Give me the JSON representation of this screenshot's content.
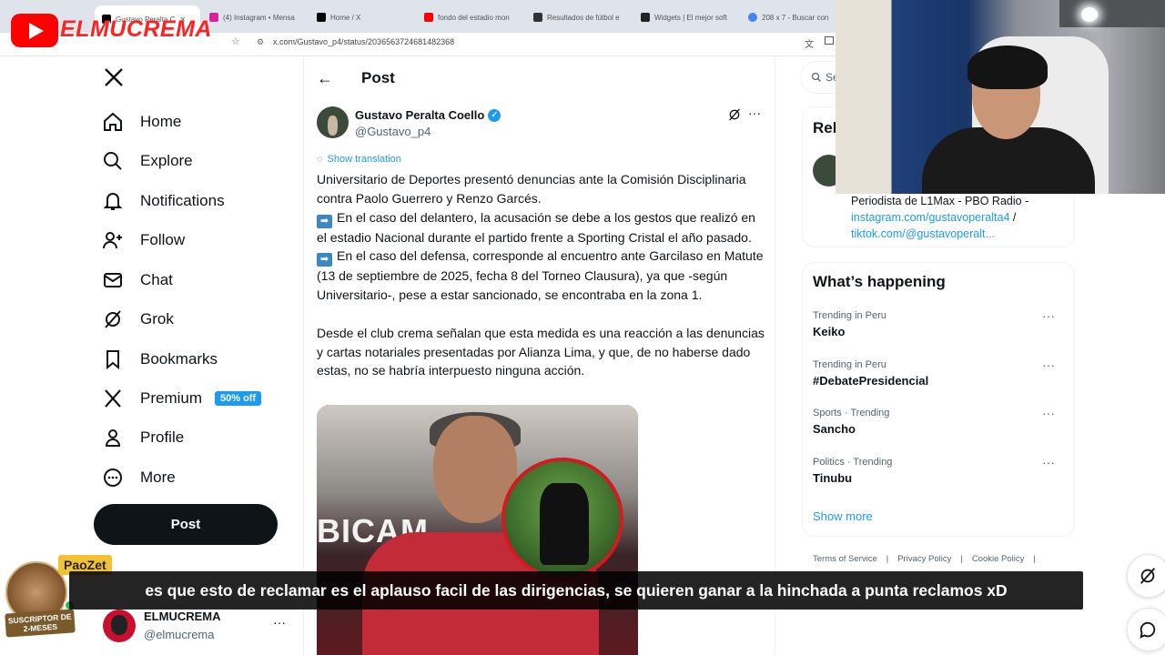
{
  "browser": {
    "tabs": [
      {
        "label": "Gustavo Peralta C",
        "color": "#000000"
      },
      {
        "label": "(4) Instagram • Mensa",
        "color": "#d6249f"
      },
      {
        "label": "Home / X",
        "color": "#000000"
      },
      {
        "label": "fondo del estadio mon",
        "color": "#ff0000"
      },
      {
        "label": "Resultados de fútbol e",
        "color": "#333333"
      },
      {
        "label": "Widgets | El mejor soft",
        "color": "#222222"
      },
      {
        "label": "208 x 7 - Buscar con",
        "color": "#4285f4"
      }
    ],
    "url": "x.com/Gustavo_p4/status/2036563724681482368"
  },
  "stream": {
    "brand": "ELMUCREMA"
  },
  "nav": {
    "items": [
      {
        "label": "Home",
        "icon": "home-icon"
      },
      {
        "label": "Explore",
        "icon": "search-icon"
      },
      {
        "label": "Notifications",
        "icon": "bell-icon"
      },
      {
        "label": "Follow",
        "icon": "person-add-icon"
      },
      {
        "label": "Chat",
        "icon": "envelope-icon"
      },
      {
        "label": "Grok",
        "icon": "grok-icon"
      },
      {
        "label": "Bookmarks",
        "icon": "bookmark-icon"
      },
      {
        "label": "Premium",
        "icon": "x-icon"
      },
      {
        "label": "Profile",
        "icon": "person-icon"
      },
      {
        "label": "More",
        "icon": "more-circle-icon"
      }
    ],
    "premium_badge": "50% off",
    "post_button": "Post"
  },
  "account": {
    "name": "ELMUCREMA",
    "handle": "@elmucrema",
    "more": "···"
  },
  "post": {
    "header": "Post",
    "author_name": "Gustavo Peralta Coello",
    "author_handle": "@Gustavo_p4",
    "show_translation": "Show translation",
    "more": "···",
    "paragraph1": "Universitario de Deportes presentó denuncias ante la Comisión Disciplinaria contra Paolo Guerrero y Renzo Garcés.",
    "paragraph2": "En el caso del delantero, la acusación se debe a los gestos que realizó en el estadio Nacional durante el partido frente a Sporting Cristal el año pasado.",
    "paragraph3": "En el caso del defensa, corresponde al encuentro ante Garcilaso en Matute (13 de septiembre de 2025, fecha 8 del Torneo Clausura), ya que -según Universitario-, pese a estar sancionado, se encontraba en la zona 1.",
    "paragraph4": "Desde el club crema señalan que esta medida es una reacción a las denuncias y cartas notariales presentadas por Alianza Lima, y que, de no haberse dado estas, no se habría interpuesto ninguna acción.",
    "image_text": "BICAM"
  },
  "right": {
    "search_placeholder": "Se",
    "relevant_title": "Rel",
    "bio": "Periodista de L1Max - PBO Radio -",
    "bio_link1": "instagram.com/gustavoperalta4",
    "bio_sep": " /",
    "bio_link2": "tiktok.com/@gustavoperalt...",
    "happening_title": "What’s happening",
    "trends": [
      {
        "meta": "Trending in Peru",
        "name": "Keiko"
      },
      {
        "meta": "Trending in Peru",
        "name": "#DebatePresidencial"
      },
      {
        "meta": "Sports · Trending",
        "name": "Sancho"
      },
      {
        "meta": "Politics · Trending",
        "name": "Tinubu"
      }
    ],
    "trend_more": "···",
    "show_more": "Show more",
    "footer": [
      "Terms of Service",
      "|",
      "Privacy Policy",
      "|",
      "Cookie Policy",
      "|"
    ]
  },
  "overlay": {
    "chat_user": "PaoZet",
    "subtitle": "es que esto de reclamar es el aplauso facil de las dirigencias, se quieren ganar a la hinchada a punta reclamos xD",
    "sub_badge": "SUSCRIPTOR DE 2-MESES"
  },
  "colors": {
    "accent": "#1d9bf0",
    "text": "#0f1419",
    "muted": "#536471",
    "brand_red": "#ff2222"
  }
}
